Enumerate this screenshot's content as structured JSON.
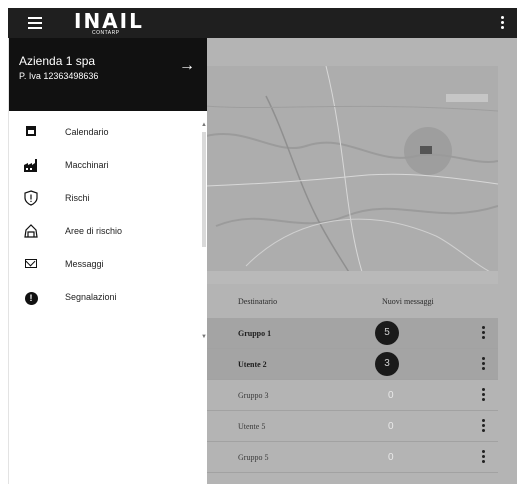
{
  "appbar": {
    "menu_icon": "hamburger-icon",
    "brand": "INAIL",
    "brand_sub": "CONTARP",
    "more_icon": "more-vert-icon"
  },
  "drawer": {
    "company": "Azienda 1 spa",
    "vat": "P. Iva 12363498636",
    "arrow": "→",
    "items": [
      {
        "label": "Calendario",
        "icon": "calendar-icon"
      },
      {
        "label": "Macchinari",
        "icon": "factory-icon"
      },
      {
        "label": "Rischi",
        "icon": "warning-shield-icon"
      },
      {
        "label": "Aree di rischio",
        "icon": "area-icon"
      },
      {
        "label": "Messaggi",
        "icon": "mail-icon"
      },
      {
        "label": "Segnalazioni",
        "icon": "report-icon"
      }
    ]
  },
  "table": {
    "header_destinatario": "Destinatario",
    "header_nuovi": "Nuovi messaggi",
    "rows": [
      {
        "name": "Gruppo 1",
        "count": "5",
        "bold": true
      },
      {
        "name": "Utente 2",
        "count": "3",
        "bold": true
      },
      {
        "name": "Gruppo 3",
        "count": "0",
        "bold": false
      },
      {
        "name": "Utente 5",
        "count": "0",
        "bold": false
      },
      {
        "name": "Gruppo 5",
        "count": "0",
        "bold": false
      }
    ]
  }
}
